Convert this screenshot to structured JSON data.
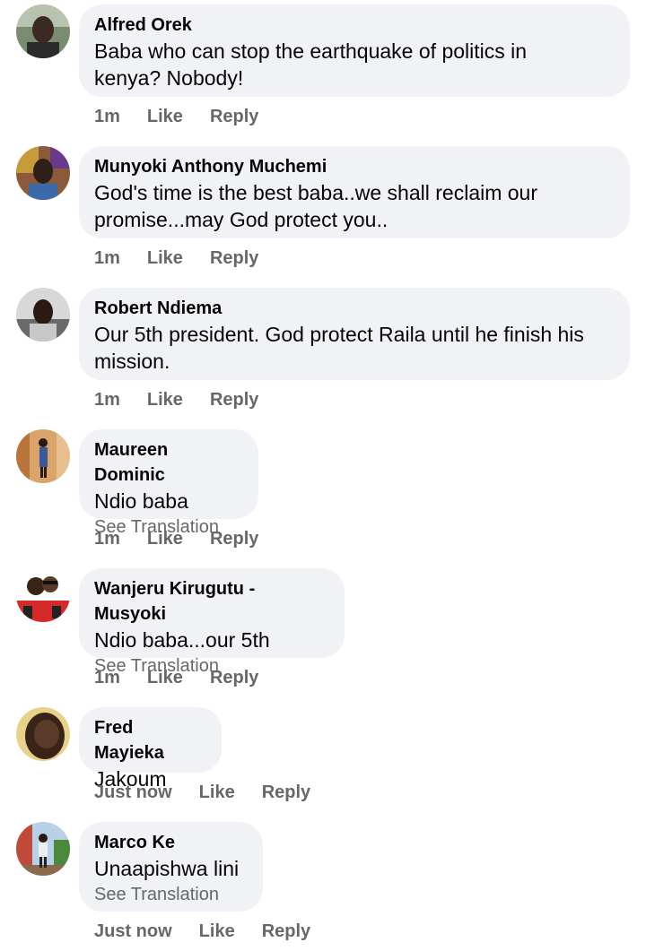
{
  "comments": [
    {
      "author": "Alfred Orek",
      "text_lines": [
        "Baba who can stop the earthquake of politics in",
        "kenya? Nobody!"
      ],
      "time": "1m",
      "like": "Like",
      "reply": "Reply"
    },
    {
      "author": "Munyoki Anthony Muchemi",
      "text_lines": [
        "God's time is the best baba..we shall reclaim our",
        "promise...may God protect you.."
      ],
      "time": "1m",
      "like": "Like",
      "reply": "Reply"
    },
    {
      "author": "Robert Ndiema",
      "text_lines": [
        "Our 5th president. God protect Raila until he finish his",
        "mission."
      ],
      "time": "1m",
      "like": "Like",
      "reply": "Reply"
    },
    {
      "author": "Maureen Dominic",
      "text_lines": [
        "Ndio baba"
      ],
      "see_translation": "See Translation",
      "time": "1m",
      "like": "Like",
      "reply": "Reply"
    },
    {
      "author": "Wanjeru Kirugutu - Musyoki",
      "text_lines": [
        "Ndio baba...our 5th"
      ],
      "see_translation": "See Translation",
      "time": "1m",
      "like": "Like",
      "reply": "Reply"
    },
    {
      "author": "Fred Mayieka",
      "text_lines": [
        "Jakoum"
      ],
      "time": "Just now",
      "like": "Like",
      "reply": "Reply"
    },
    {
      "author": "Marco Ke",
      "text_lines": [
        "Unaapishwa lini"
      ],
      "see_translation": "See Translation",
      "time": "Just now",
      "like": "Like",
      "reply": "Reply"
    }
  ],
  "colors": {
    "bubble": "#f0f2f5",
    "meta": "#65676b",
    "text": "#050505"
  }
}
